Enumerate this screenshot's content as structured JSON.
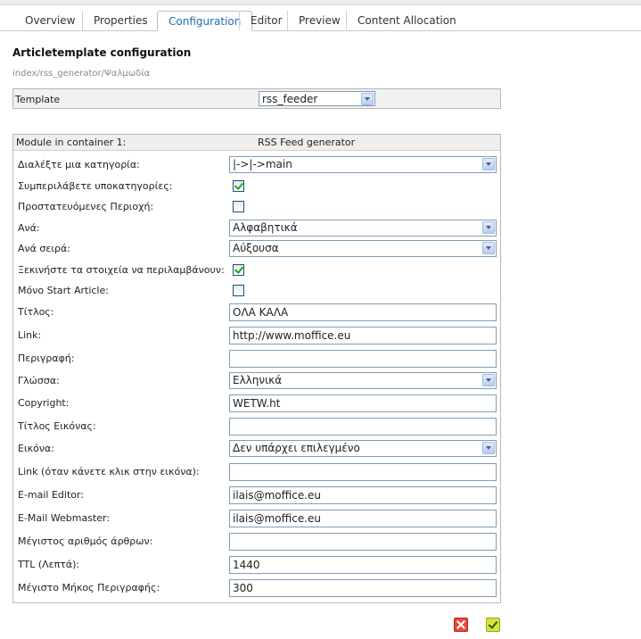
{
  "tabs": [
    {
      "label": "Overview",
      "active": false
    },
    {
      "label": "Properties",
      "active": false
    },
    {
      "label": "Configuration",
      "active": true
    },
    {
      "label": "Editor",
      "active": false
    },
    {
      "label": "Preview",
      "active": false
    },
    {
      "label": "Content Allocation",
      "active": false
    }
  ],
  "page": {
    "title": "Articletemplate configuration",
    "breadcrumb": "index/rss_generator/Ψαλμωδία"
  },
  "template": {
    "label": "Template",
    "value": "rss_feeder"
  },
  "module": {
    "header_label": "Module in container 1:",
    "header_value": "RSS Feed generator"
  },
  "fields": [
    {
      "label": "Διαλέξτε μια κατηγορία:",
      "type": "select",
      "value": "|->|->main"
    },
    {
      "label": "Συμπεριλάβετε υποκατηγορίες:",
      "type": "checkbox",
      "checked": true
    },
    {
      "label": "Προστατευόμενες Περιοχή:",
      "type": "checkbox",
      "checked": false
    },
    {
      "label": "Ανά:",
      "type": "select",
      "value": "Αλφαβητικά"
    },
    {
      "label": "Ανά σειρά:",
      "type": "select",
      "value": "Αύξουσα"
    },
    {
      "label": "Ξεκινήστε τα στοιχεία να περιλαμβάνουν:",
      "type": "checkbox",
      "checked": true
    },
    {
      "label": "Μόνο Start Article:",
      "type": "checkbox",
      "checked": false
    },
    {
      "label": "Τίτλος:",
      "type": "text",
      "value": "ΟΛΑ ΚΑΛΑ"
    },
    {
      "label": "Link:",
      "type": "text",
      "value": "http://www.moffice.eu"
    },
    {
      "label": "Περιγραφή:",
      "type": "text",
      "value": ""
    },
    {
      "label": "Γλώσσα:",
      "type": "select",
      "value": "Ελληνικά"
    },
    {
      "label": "Copyright:",
      "type": "text",
      "value": "WETW.ht"
    },
    {
      "label": "Τίτλος Εικόνας:",
      "type": "text",
      "value": ""
    },
    {
      "label": "Εικόνα:",
      "type": "select",
      "value": "Δεν υπάρχει επιλεγμένο"
    },
    {
      "label": "Link (όταν κάνετε κλικ στην εικόνα):",
      "type": "text",
      "value": ""
    },
    {
      "label": "E-mail Editor:",
      "type": "text",
      "value": "ilais@moffice.eu"
    },
    {
      "label": "E-Mail Webmaster:",
      "type": "text",
      "value": "ilais@moffice.eu"
    },
    {
      "label": "Μέγιστος αριθμός άρθρων:",
      "type": "text",
      "value": ""
    },
    {
      "label": "TTL (Λεπτά):",
      "type": "text",
      "value": "1440"
    },
    {
      "label": "Μέγιστο Μήκος Περιγραφής:",
      "type": "text",
      "value": "300"
    }
  ],
  "actions": {
    "cancel_icon": "cancel-icon",
    "save_icon": "save-check-icon"
  },
  "colors": {
    "active_tab": "#1f6fb5",
    "cancel": "#e84a3c",
    "save": "#d9e43a"
  }
}
